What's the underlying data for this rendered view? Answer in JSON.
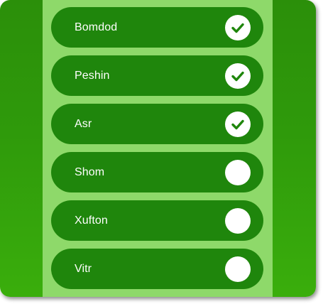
{
  "prayers": [
    {
      "label": "Bomdod",
      "done": true
    },
    {
      "label": "Peshin",
      "done": true
    },
    {
      "label": "Asr",
      "done": true
    },
    {
      "label": "Shom",
      "done": false
    },
    {
      "label": "Xufton",
      "done": false
    },
    {
      "label": "Vitr",
      "done": false
    }
  ],
  "colors": {
    "background_green": "#2f9a0b",
    "panel_light_green": "#8ed96a",
    "row_green": "#1f860c",
    "check_fill": "#ffffff",
    "check_mark": "#1f860c"
  },
  "icons": {
    "checked": "checkmark-icon",
    "unchecked": "empty-circle-icon"
  }
}
